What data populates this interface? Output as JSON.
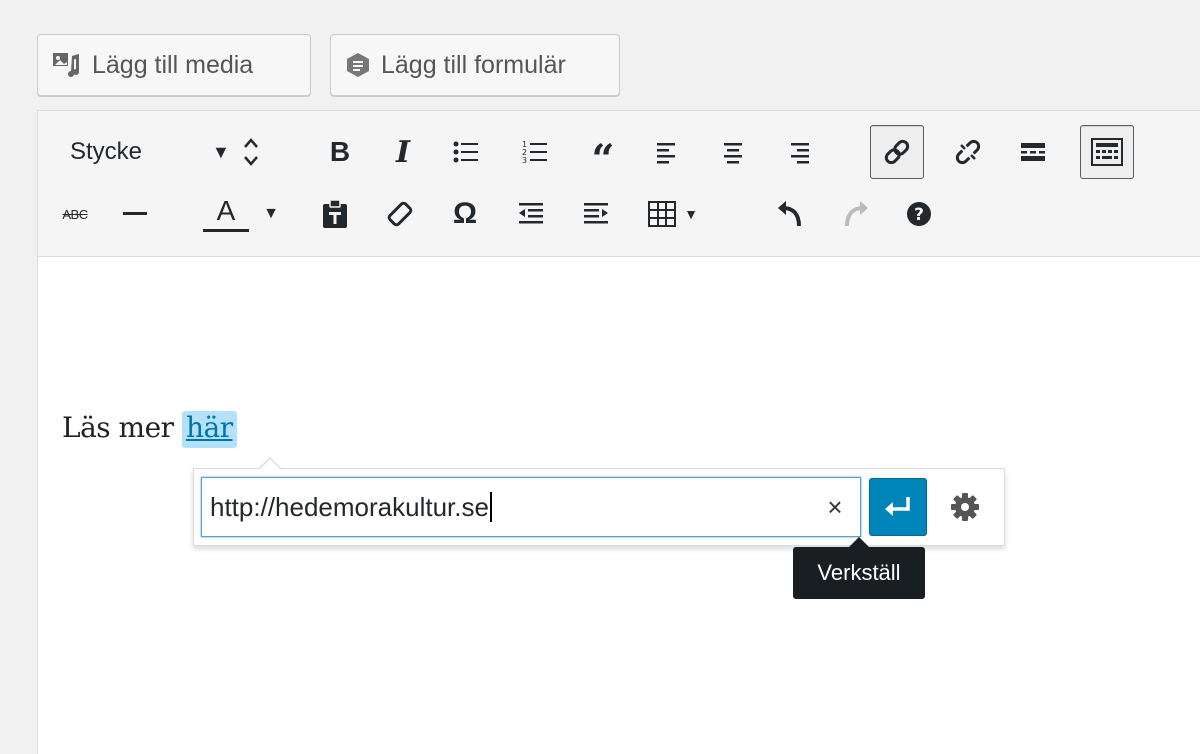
{
  "media_buttons": {
    "add_media_label": "Lägg till media",
    "add_form_label": "Lägg till formulär"
  },
  "toolbar": {
    "format_select_value": "Stycke",
    "row1_icons": [
      "bold-icon",
      "italic-icon",
      "bullet-list-icon",
      "numbered-list-icon",
      "blockquote-icon",
      "align-left-icon",
      "align-center-icon",
      "align-right-icon",
      "link-icon",
      "unlink-icon",
      "read-more-icon",
      "toolbar-toggle-icon"
    ],
    "row2_icons": [
      "strikethrough-icon",
      "horizontal-line-icon",
      "text-color-icon",
      "paste-as-text-icon",
      "clear-formatting-icon",
      "special-character-icon",
      "outdent-icon",
      "indent-icon",
      "table-icon",
      "undo-icon",
      "redo-icon",
      "help-icon"
    ],
    "strikethrough_text": "ABC",
    "text_color_letter": "A",
    "bold_letter": "B",
    "italic_letter": "I",
    "special_char": "Ω"
  },
  "content": {
    "text_before_link": "Läs mer ",
    "link_text": "här"
  },
  "link_dialog": {
    "url_value": "http://hedemorakultur.se",
    "clear_symbol": "×",
    "apply_tooltip": "Verkställ"
  },
  "colors": {
    "accent": "#0085ba",
    "link": "#0073aa",
    "link_highlight": "#b4e1fa",
    "tooltip_bg": "#191e23"
  }
}
